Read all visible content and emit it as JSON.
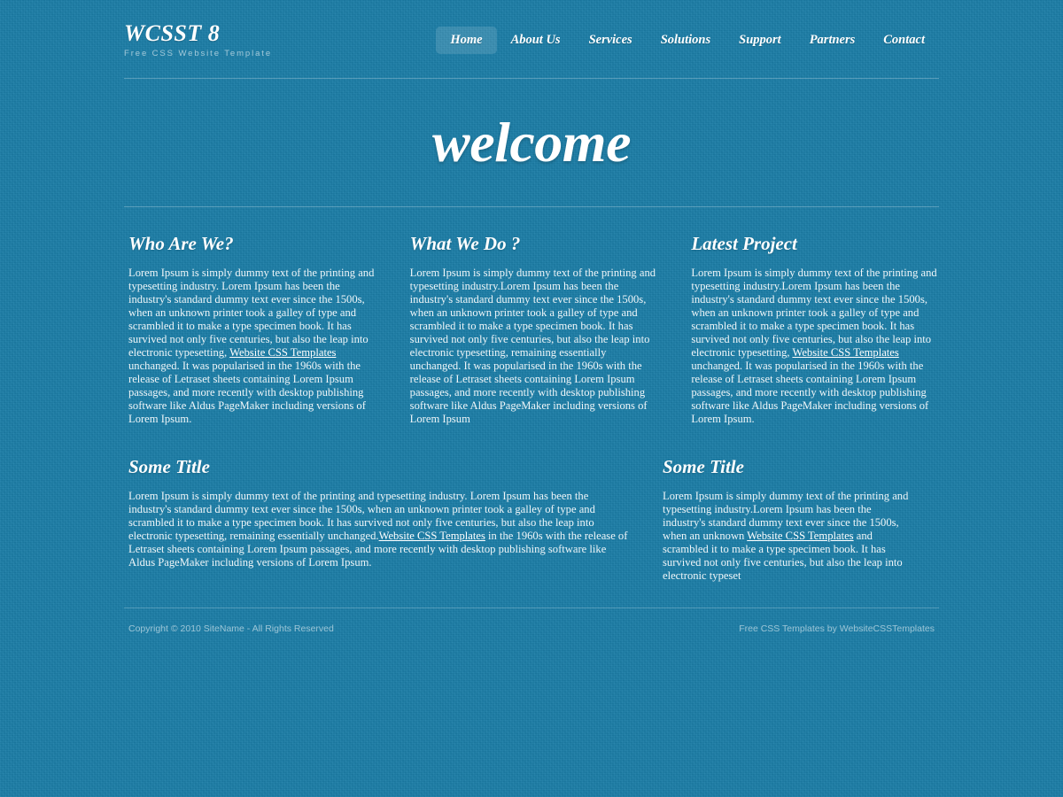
{
  "site": {
    "logo_title": "WCSST 8",
    "logo_tagline": "Free CSS Website Template",
    "background_color": "#1b7ea8",
    "text_color": "#ffffff"
  },
  "nav": {
    "items": [
      {
        "label": "Home",
        "active": true
      },
      {
        "label": "About Us",
        "active": false
      },
      {
        "label": "Services",
        "active": false
      },
      {
        "label": "Solutions",
        "active": false
      },
      {
        "label": "Support",
        "active": false
      },
      {
        "label": "Partners",
        "active": false
      },
      {
        "label": "Contact",
        "active": false
      }
    ]
  },
  "banner": {
    "title": "welcome"
  },
  "columns_row1": [
    {
      "title": "Who Are We?",
      "text_before_link": "Lorem Ipsum is simply dummy text of the printing and typesetting industry. Lorem Ipsum has been the industry's standard dummy text ever since the 1500s, when an unknown printer took a galley of type and scrambled it to make a type specimen book. It has survived not only five centuries, but also the leap into electronic typesetting, ",
      "link_label": "Website CSS Templates",
      "text_after_link": " unchanged. It was popularised in the 1960s with the release of Letraset sheets containing Lorem Ipsum passages, and more recently with desktop publishing software like Aldus PageMaker including versions of Lorem Ipsum."
    },
    {
      "title": "What We Do ?",
      "text_before_link": "Lorem Ipsum is simply dummy text of the printing and typesetting industry.Lorem Ipsum has been the industry's standard dummy text ever since the 1500s, when an unknown printer took a galley of type and scrambled it to make a type specimen book. It has survived not only five centuries, but also the leap into electronic typesetting, remaining essentially unchanged. It was popularised in the 1960s with the release of Letraset sheets containing Lorem Ipsum passages, and more recently with desktop publishing software like Aldus PageMaker including versions of Lorem Ipsum",
      "link_label": "",
      "text_after_link": ""
    },
    {
      "title": "Latest Project",
      "text_before_link": "Lorem Ipsum is simply dummy text of the printing and typesetting industry.Lorem Ipsum has been the industry's standard dummy text ever since the 1500s, when an unknown printer took a galley of type and scrambled it to make a type specimen book. It has survived not only five centuries, but also the leap into electronic typesetting, ",
      "link_label": "Website CSS Templates",
      "text_after_link": " unchanged. It was popularised in the 1960s with the release of Letraset sheets containing Lorem Ipsum passages, and more recently with desktop publishing software like Aldus PageMaker including versions of Lorem Ipsum."
    }
  ],
  "columns_row2": [
    {
      "title": "Some Title",
      "text_before_link": "Lorem Ipsum is simply dummy text of the printing and typesetting industry. Lorem Ipsum has been the industry's standard dummy text ever since the 1500s, when an unknown printer took a galley of type and scrambled it to make a type specimen book. It has survived not only five centuries, but also the leap into electronic typesetting, remaining essentially unchanged.",
      "link_label": "Website CSS Templates",
      "text_after_link": " in the 1960s with the release of Letraset sheets containing Lorem Ipsum passages, and more recently with desktop publishing software like Aldus PageMaker including versions of Lorem Ipsum."
    },
    {
      "title": "Some Title",
      "text_before_link": "Lorem Ipsum is simply dummy text of the printing and typesetting industry.Lorem Ipsum has been the industry's standard dummy text ever since the 1500s, when an unknown ",
      "link_label": "Website CSS Templates",
      "text_after_link": " and scrambled it to make a type specimen book. It has survived not only five centuries, but also the leap into electronic typeset"
    }
  ],
  "footer": {
    "left": "Copyright © 2010 SiteName - All Rights Reserved",
    "right": "Free CSS Templates by WebsiteCSSTemplates"
  }
}
